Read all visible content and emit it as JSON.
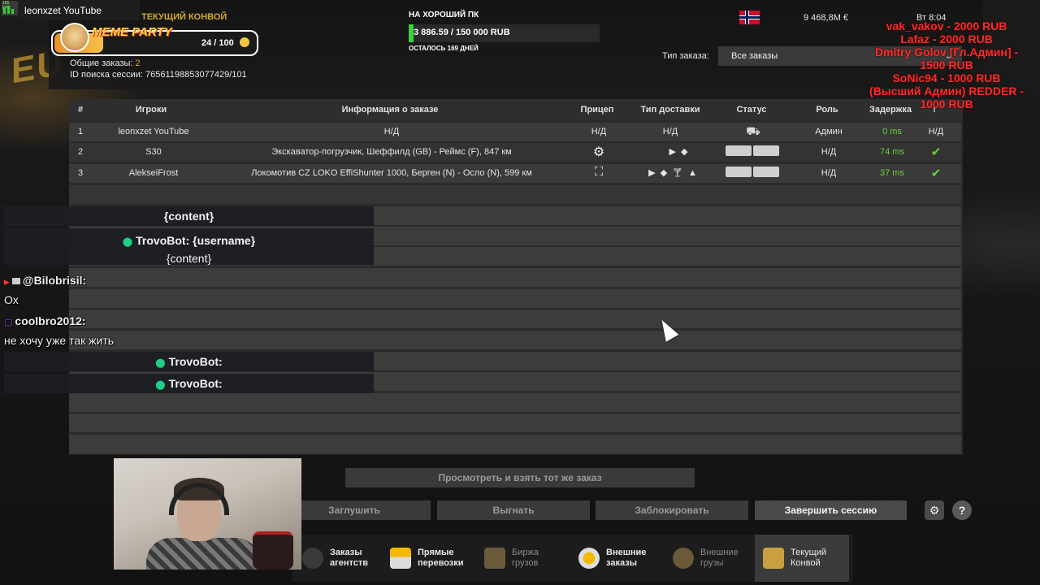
{
  "stream": {
    "channel_name": "leonxzet YouTube",
    "fps_label": "165 FPS"
  },
  "header": {
    "convoy_title": "ТЕКУЩИЙ КОНВОЙ",
    "meme_party": {
      "title": "MEME PARTY",
      "count": "24 / 100"
    },
    "total_orders_label": "Общие заказы:",
    "total_orders_value": "2",
    "session_id_label": "ID поиска сессии:",
    "session_id_value": "76561198853077429/101",
    "goal": {
      "title": "НА ХОРОШИЙ ПК",
      "amount": "3 886.59 / 150 000 RUB",
      "progress_fraction": 0.026,
      "remaining": "ОСТАЛОСЬ 169 ДНЕЙ"
    },
    "money": "9 468,8M €",
    "clock": "Вт 8:04",
    "order_type_label": "Тип заказа:",
    "order_type_value": "Все заказы"
  },
  "donations": [
    "vak_vakov - 2000 RUB",
    "Lafaz - 2000 RUB",
    "Dmitry Golov [Гл.Админ] -",
    "1500 RUB",
    "SoNic94 - 1000 RUB",
    "(Высший Админ) REDDER -",
    "1000 RUB"
  ],
  "table": {
    "columns": [
      "#",
      "Игроки",
      "Информация о заказе",
      "Прицеп",
      "Тип доставки",
      "Статус",
      "Роль",
      "Задержка",
      "!"
    ],
    "rows": [
      {
        "num": "1",
        "player": "leonxzet YouTube",
        "order": "Н/Д",
        "trailer": "Н/Д",
        "delivery": "Н/Д",
        "role": "Админ",
        "ping": "0 ms",
        "ready": "Н/Д"
      },
      {
        "num": "2",
        "player": "S30",
        "order": "Экскаватор-погрузчик, Шеффилд (GB) - Реймс (F), 847 км",
        "trailer": "",
        "delivery": "",
        "role": "Н/Д",
        "ping": "74 ms",
        "ready": "✔"
      },
      {
        "num": "3",
        "player": "AlekseiFrost",
        "order": "Локомотив CZ LOKO EffiShunter 1000, Берген (N) - Осло (N), 599 км",
        "trailer": "",
        "delivery": "",
        "role": "Н/Д",
        "ping": "37 ms",
        "ready": "✔"
      }
    ]
  },
  "chat": {
    "msg1_content": "{content}",
    "msg2_user": "TrovoBot: {username}",
    "msg2_content": "{content}",
    "msg3_user": "@Bilobrisil:",
    "msg3_text": "Ох",
    "msg4_user": "coolbro2012:",
    "msg4_text": "не хочу уже так жить",
    "msg5_user": "TrovoBot:",
    "msg6_user": "TrovoBot:"
  },
  "buttons": {
    "view_take": "Просмотреть и взять тот же заказ",
    "mute": "Заглушить",
    "kick": "Выгнать",
    "block": "Заблокировать",
    "end_session": "Завершить сессию",
    "help": "?"
  },
  "nav": [
    {
      "line1": "Заказы",
      "line2": "агентств"
    },
    {
      "line1": "Прямые",
      "line2": "перевозки"
    },
    {
      "line1": "Биржа",
      "line2": "грузов"
    },
    {
      "line1": "Внешние",
      "line2": "заказы"
    },
    {
      "line1": "Внешние",
      "line2": "грузы"
    },
    {
      "line1": "Текущий",
      "line2": "Конвой"
    }
  ],
  "colors": {
    "accent_green": "#6ccf3a",
    "donation_red": "#ff2a2a",
    "progress_green": "#3cd13c"
  }
}
